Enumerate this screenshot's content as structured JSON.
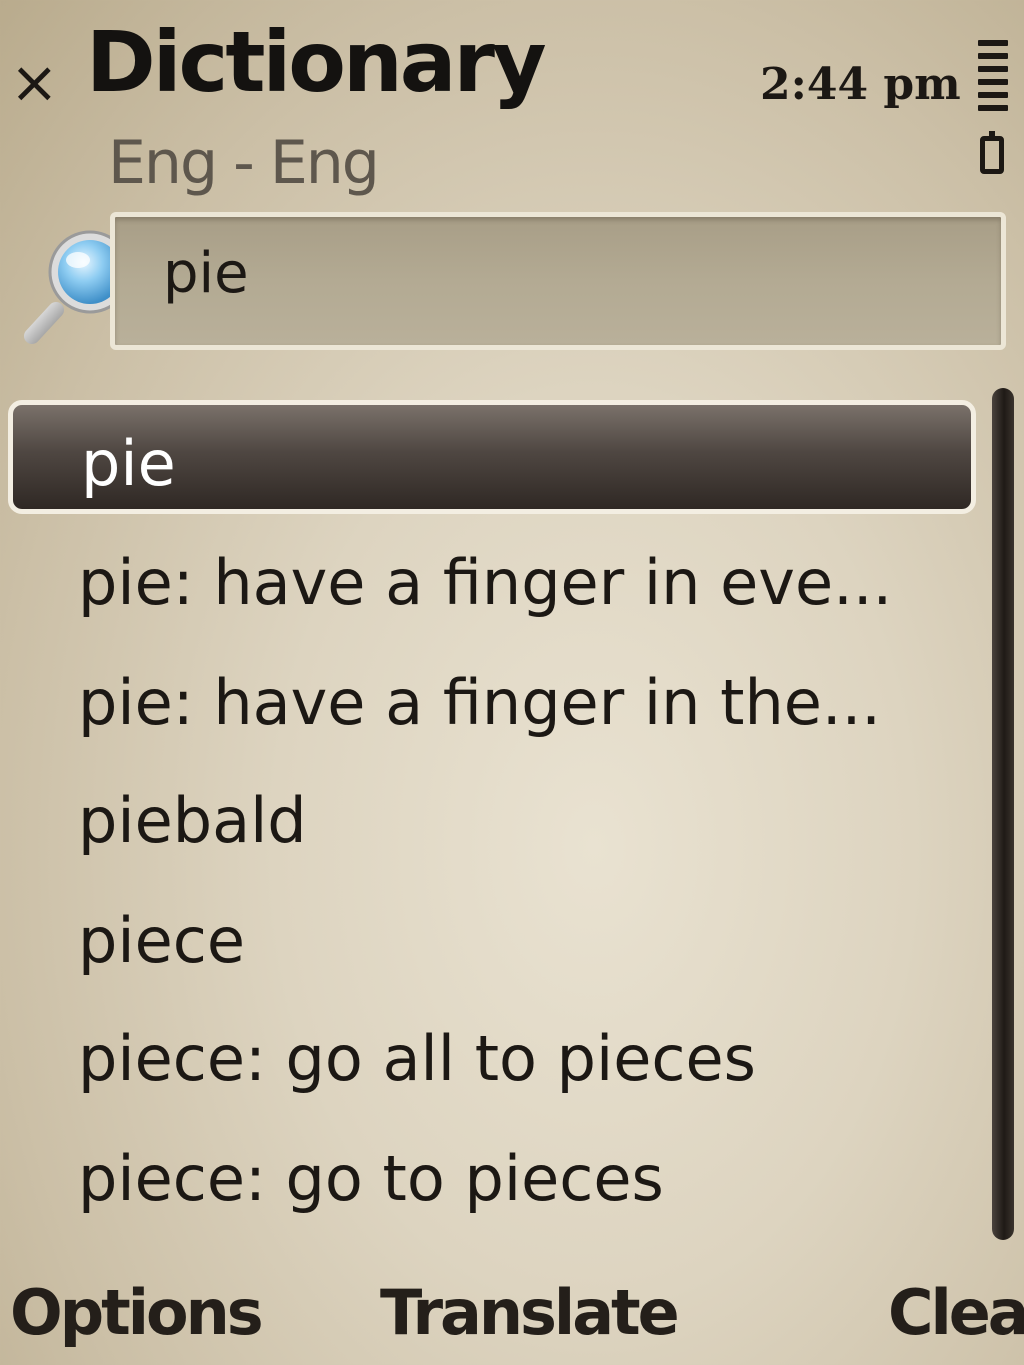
{
  "header": {
    "title": "Dictionary",
    "subtitle": "Eng - Eng",
    "close_glyph": "×",
    "time": "2:44 pm",
    "icons": [
      "close-icon",
      "signal-icon",
      "battery-icon",
      "search-icon"
    ]
  },
  "search": {
    "value": "pie"
  },
  "results": {
    "selected_index": 0,
    "items": [
      "pie",
      "pie: have a finger in eve...",
      "pie: have a finger in the...",
      "piebald",
      "piece",
      "piece: go all to pieces",
      "piece: go to pieces"
    ]
  },
  "softkeys": {
    "left": "Options",
    "middle": "Translate",
    "right": "Clear"
  },
  "colors": {
    "background": "#ddd4c0",
    "selection": "#3a3330",
    "text": "#1c1814",
    "subtitle": "#5e574d"
  }
}
